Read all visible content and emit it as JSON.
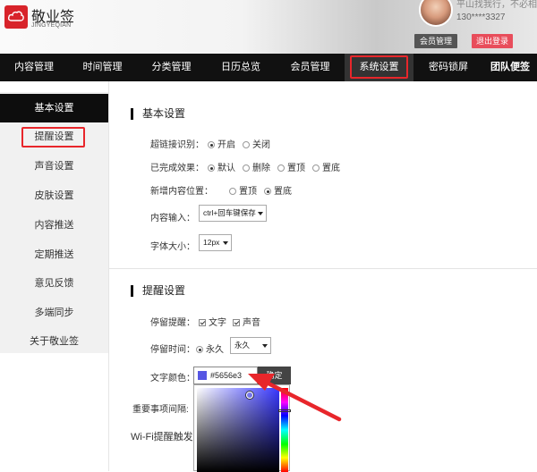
{
  "header": {
    "brand": "敬业签",
    "brand_sub": "JINGYEQIAN",
    "promo_text": "平山找我行，不必相",
    "phone": "130****3327",
    "member_button": "会员管理",
    "logout_button": "退出登录"
  },
  "nav": {
    "items": [
      "内容管理",
      "时间管理",
      "分类管理",
      "日历总览",
      "会员管理",
      "系统设置",
      "密码锁屏",
      "团队便签"
    ],
    "active": "系统设置"
  },
  "sidebar": {
    "items": [
      "基本设置",
      "提醒设置",
      "声音设置",
      "皮肤设置",
      "内容推送",
      "定期推送",
      "意见反馈",
      "多端同步",
      "关于敬业签"
    ],
    "active": "基本设置",
    "highlighted": "提醒设置"
  },
  "basic": {
    "title": "基本设置",
    "link_label": "超链接识别：",
    "link_options": [
      "开启",
      "关闭"
    ],
    "link_selected": "开启",
    "done_label": "已完成效果：",
    "done_options": [
      "默认",
      "删除",
      "置顶",
      "置底"
    ],
    "done_selected": "默认",
    "newpos_label": "新增内容位置：",
    "newpos_options": [
      "置顶",
      "置底"
    ],
    "newpos_selected": "置底",
    "input_label": "内容输入：",
    "input_value": "ctrl+回车键保存",
    "font_label": "字体大小：",
    "font_value": "12px"
  },
  "reminder": {
    "title": "提醒设置",
    "stay_label": "停留提醒：",
    "stay_text_option": "文字",
    "stay_sound_option": "声音",
    "stay_text_checked": true,
    "stay_sound_checked": true,
    "time_label": "停留时间：",
    "time_radio": "永久",
    "time_value": "永久",
    "color_label": "文字颜色：",
    "color_value": "#5656e3",
    "confirm": "确定",
    "important_label": "重要事项间隔:",
    "wifi_label": "Wi-Fi提醒触发间"
  },
  "colors": {
    "accent_red": "#e8262b",
    "nav_bg": "#111111",
    "selected_color": "#5656e3"
  }
}
